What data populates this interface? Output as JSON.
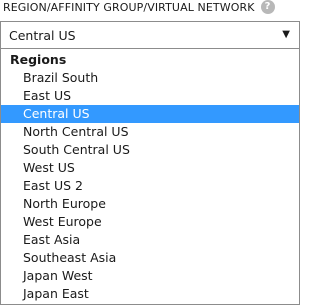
{
  "field": {
    "label": "REGION/AFFINITY GROUP/VIRTUAL NETWORK",
    "help_icon": "?"
  },
  "select": {
    "value": "Central US",
    "chevron_icon": "chevron-down-icon",
    "chevron_glyph": "▼"
  },
  "dropdown": {
    "group_header": "Regions",
    "selected_option": "Central US",
    "options": [
      "Brazil South",
      "East US",
      "Central US",
      "North Central US",
      "South Central US",
      "West US",
      "East US 2",
      "North Europe",
      "West Europe",
      "East Asia",
      "Southeast Asia",
      "Japan West",
      "Japan East"
    ]
  },
  "colors": {
    "selection_background": "#3399ff",
    "selection_text": "#ffffff",
    "border": "#8c8c8c",
    "help_icon_background": "#b8b8b8"
  }
}
